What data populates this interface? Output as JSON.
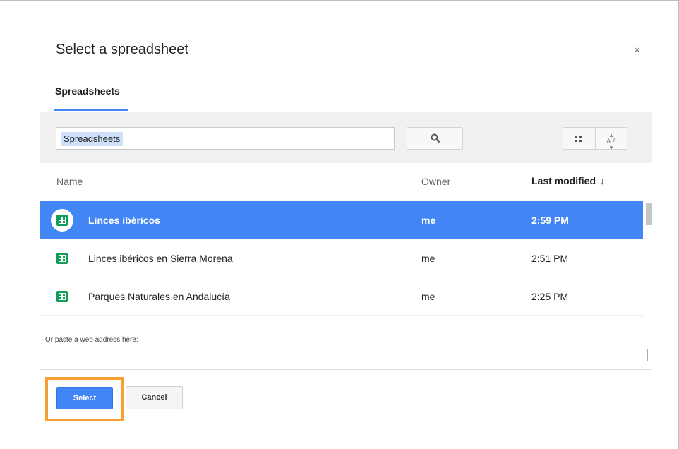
{
  "dialog": {
    "title": "Select a spreadsheet",
    "close_icon": "×"
  },
  "tabs": [
    {
      "label": "Spreadsheets",
      "active": true
    }
  ],
  "toolbar": {
    "search_value": "Spreadsheets",
    "search_icon": "search-icon",
    "view_icon": "grid-view-icon",
    "sort_icon": "sort-az-icon"
  },
  "list": {
    "columns": {
      "name": "Name",
      "owner": "Owner",
      "modified": "Last modified",
      "modified_arrow": "↓"
    },
    "rows": [
      {
        "name": "Linces ibéricos",
        "owner": "me",
        "modified": "2:59 PM",
        "selected": true
      },
      {
        "name": "Linces ibéricos en Sierra Morena",
        "owner": "me",
        "modified": "2:51 PM",
        "selected": false
      },
      {
        "name": "Parques Naturales en Andalucía",
        "owner": "me",
        "modified": "2:25 PM",
        "selected": false
      }
    ]
  },
  "paste": {
    "label": "Or paste a web address here:",
    "value": ""
  },
  "footer": {
    "select_label": "Select",
    "cancel_label": "Cancel"
  },
  "colors": {
    "accent": "#4285f4",
    "sheets_green": "#0f9d58",
    "highlight": "#f7a033"
  }
}
